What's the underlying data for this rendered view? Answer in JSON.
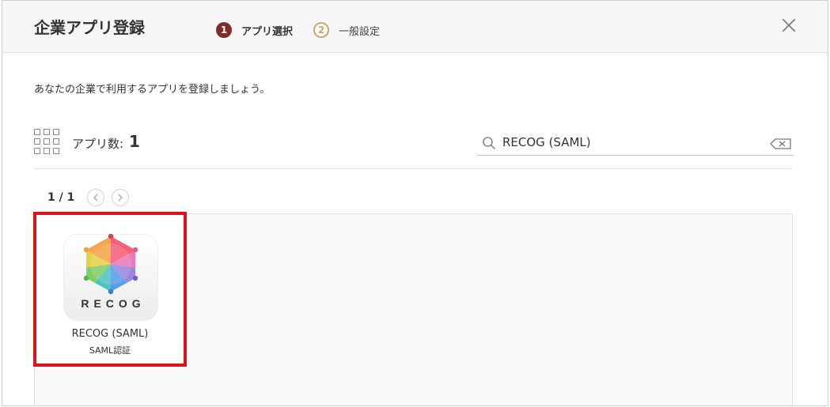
{
  "dialog": {
    "title": "企業アプリ登録",
    "steps": [
      {
        "number": "1",
        "label": "アプリ選択",
        "state": "active"
      },
      {
        "number": "2",
        "label": "一般設定",
        "state": "inactive"
      }
    ],
    "close_icon": "close-icon"
  },
  "description": "あなたの企業で利用するアプリを登録しましょう。",
  "toolbar": {
    "count_label": "アプリ数:",
    "count_value": "1",
    "view_icon": "grid-view-icon"
  },
  "search": {
    "value": "RECOG (SAML)",
    "icon": "search-icon",
    "clear_icon": "clear-input-icon"
  },
  "pagination": {
    "label": "1 / 1",
    "prev_icon": "chevron-left-icon",
    "next_icon": "chevron-right-icon"
  },
  "apps": [
    {
      "logo_text": "RECOG",
      "name": "RECOG (SAML)",
      "auth_type": "SAML認証",
      "selected": true
    }
  ],
  "colors": {
    "step_active": "#7d2c2c",
    "step_inactive": "#c9a86c",
    "selection_border": "#e0101c"
  }
}
